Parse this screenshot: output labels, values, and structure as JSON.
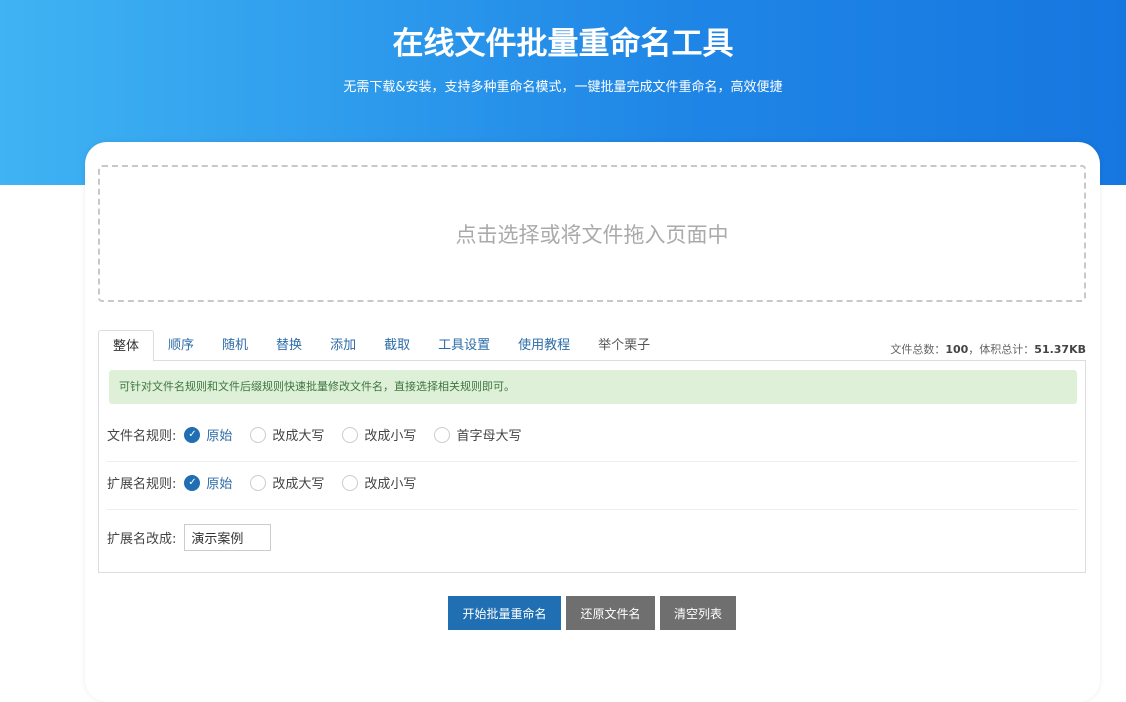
{
  "header": {
    "title": "在线文件批量重命名工具",
    "subtitle": "无需下载&安装，支持多种重命名模式，一键批量完成文件重命名，高效便捷"
  },
  "dropzone": {
    "text": "点击选择或将文件拖入页面中"
  },
  "tabs": [
    "整体",
    "顺序",
    "随机",
    "替换",
    "添加",
    "截取",
    "工具设置",
    "使用教程",
    "举个栗子"
  ],
  "stats": {
    "count_label": "文件总数：",
    "count": "100",
    "sep": "，",
    "size_label": "体积总计：",
    "size": "51.37KB"
  },
  "alert": "可针对文件名规则和文件后缀规则快速批量修改文件名，直接选择相关规则即可。",
  "filename_rule": {
    "label": "文件名规则:",
    "options": [
      "原始",
      "改成大写",
      "改成小写",
      "首字母大写"
    ],
    "selected": 0
  },
  "ext_rule": {
    "label": "扩展名规则:",
    "options": [
      "原始",
      "改成大写",
      "改成小写"
    ],
    "selected": 0
  },
  "ext_change": {
    "label": "扩展名改成:",
    "value": "演示案例"
  },
  "buttons": {
    "start": "开始批量重命名",
    "restore": "还原文件名",
    "clear": "清空列表"
  },
  "colors": {
    "primary": "#1f6fb2",
    "gray": "#6f6f6f"
  }
}
